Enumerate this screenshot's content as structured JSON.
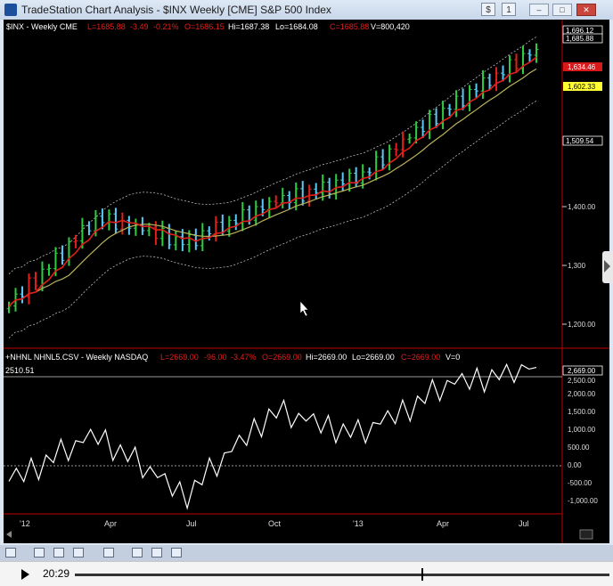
{
  "window": {
    "title": "TradeStation Chart Analysis - $INX Weekly [CME] S&P 500 Index",
    "toolbar_btn1": "$",
    "toolbar_btn2": "1"
  },
  "price_panel": {
    "header": {
      "symbol": "$INX - Weekly  CME",
      "last": "L=1685.88",
      "change": "-3.49",
      "pct": "-0.21%",
      "open": "O=1686.15",
      "high": "Hi=1687.38",
      "low": "Lo=1684.08",
      "close": "C=1685.88",
      "volume": "V=800,420"
    },
    "axis_labels": [
      "1,400.00",
      "1,300",
      "1,200.00"
    ],
    "markers": {
      "top": "1,696.12",
      "last": "1,685.88",
      "red": "1,634.46",
      "yellow": "1,602.33",
      "lower": "1,509.54"
    }
  },
  "indicator_panel": {
    "header": {
      "name": "+NHNL NHNL5.CSV - Weekly  NASDAQ",
      "last": "L=2669.00",
      "change": "-96.00",
      "pct": "-3.47%",
      "open": "O=2669.00",
      "high": "Hi=2669.00",
      "low": "Lo=2669.00",
      "close": "C=2669.00",
      "volume": "V=0"
    },
    "ref_label": "2510.51",
    "last_marker": "2,669.00",
    "axis_labels": [
      "2,500.00",
      "2,000.00",
      "1,500.00",
      "1,000.00",
      "500.00",
      "0.00",
      "-500.00",
      "-1,000.00"
    ]
  },
  "time_axis": [
    "'12",
    "Apr",
    "Jul",
    "Oct",
    "'13",
    "Apr",
    "Jul"
  ],
  "player": {
    "time": "20:29"
  },
  "colors": {
    "up": "#2ecc40",
    "down": "#5bc8f5",
    "ma_fast": "#e0201b",
    "ma_slow": "#b8b35a",
    "marker_red": "#d7191c",
    "marker_yellow": "#ffff33"
  },
  "chart_data": [
    {
      "type": "line",
      "title": "$INX Weekly",
      "x": [
        "'12",
        "Apr",
        "Jul",
        "Oct",
        "'13",
        "Apr",
        "Jul"
      ],
      "series": [
        {
          "name": "close",
          "values": [
            1220,
            1380,
            1335,
            1405,
            1455,
            1580,
            1685
          ]
        }
      ],
      "ylim": [
        1150,
        1710
      ]
    },
    {
      "type": "line",
      "title": "NHNL",
      "x": [
        "'12",
        "Apr",
        "Jul",
        "Oct",
        "'13",
        "Apr",
        "Jul"
      ],
      "series": [
        {
          "name": "NHNL",
          "values": [
            -300,
            900,
            -700,
            1500,
            900,
            2200,
            2669
          ]
        }
      ],
      "ylim": [
        -1100,
        2800
      ]
    }
  ]
}
